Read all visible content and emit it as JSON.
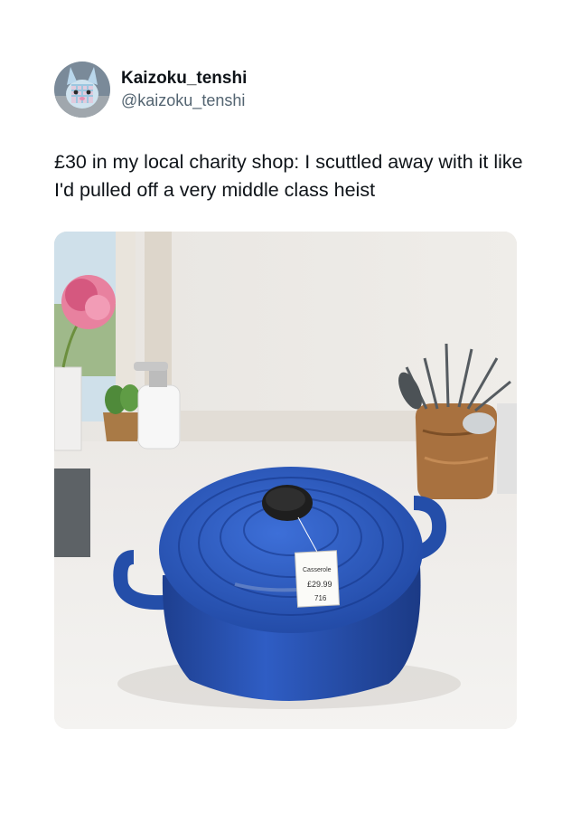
{
  "author": {
    "display_name": "Kaizoku_tenshi",
    "handle": "@kaizoku_tenshi",
    "avatar_icon": "plush-toy-avatar"
  },
  "tweet": {
    "text": "£30 in my local charity shop: I scuttled away with it like I'd pulled off a very middle class heist"
  },
  "media": {
    "price_tag_lines": [
      "Casserole",
      "£29.99",
      "716"
    ],
    "pot_color": "#2f5dc4"
  }
}
